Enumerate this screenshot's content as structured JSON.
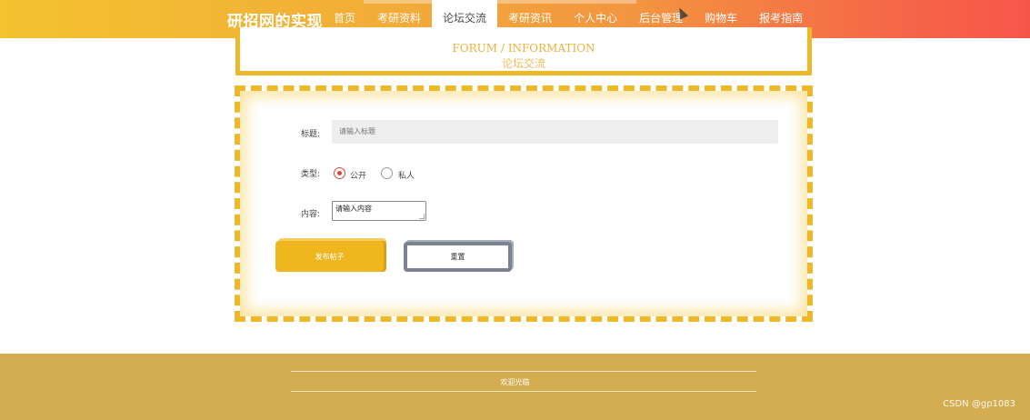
{
  "header": {
    "brand": "研招网的实现",
    "nav": [
      {
        "label": "首页",
        "active": false
      },
      {
        "label": "考研资料",
        "active": false
      },
      {
        "label": "论坛交流",
        "active": true
      },
      {
        "label": "考研资讯",
        "active": false
      },
      {
        "label": "个人中心",
        "active": false
      },
      {
        "label": "后台管理",
        "active": false
      },
      {
        "label": "购物车",
        "active": false
      },
      {
        "label": "报考指南",
        "active": false
      }
    ]
  },
  "banner": {
    "title_en": "FORUM / INFORMATION",
    "title_zh": "论坛交流"
  },
  "form": {
    "title_label": "标题:",
    "title_placeholder": "请输入标题",
    "type_label": "类型:",
    "type_options": [
      "公开",
      "私人"
    ],
    "type_selected": "公开",
    "content_label": "内容:",
    "content_placeholder": "请输入内容",
    "submit_label": "发布帖子",
    "reset_label": "重置"
  },
  "footer": {
    "text": "欢迎光临"
  },
  "watermark": "CSDN @gp1083",
  "colors": {
    "accent": "#eeb82b",
    "footer_bg": "#d3ad4f",
    "radio_selected": "#d24b3e"
  }
}
